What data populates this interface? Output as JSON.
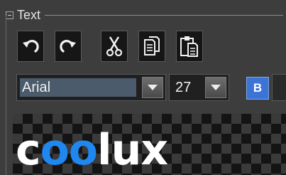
{
  "panel": {
    "title": "Text",
    "collapse_icon": "minus-box-icon"
  },
  "toolbar": {
    "undo_icon": "undo-icon",
    "redo_icon": "redo-icon",
    "cut_icon": "scissors-icon",
    "copy_icon": "copy-icon",
    "paste_icon": "clipboard-icon"
  },
  "font": {
    "family": "Arial",
    "size": "27",
    "bold_label": "B"
  },
  "preview": {
    "text_part1": "c",
    "text_part2": "oo",
    "text_part3": "lux",
    "highlight_color": "#1f88f0",
    "text_color": "#ffffff"
  }
}
